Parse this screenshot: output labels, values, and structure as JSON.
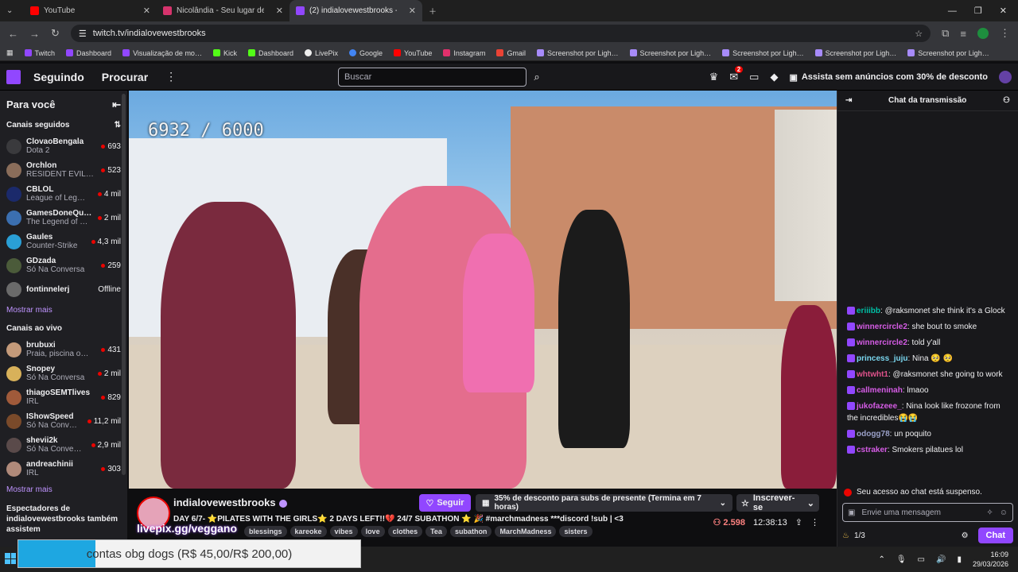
{
  "browser": {
    "tabs": [
      {
        "label": "YouTube",
        "color": "#ff0000"
      },
      {
        "label": "Nicolândia - Seu lugar de dive…",
        "color": "#d6336c"
      },
      {
        "label": "(2) indialovewestbrooks - Tw…",
        "color": "#9147ff"
      }
    ],
    "url": "twitch.tv/indialovewestbrooks",
    "bookmarks": [
      "Twitch",
      "Dashboard",
      "Visualização de mo…",
      "Kick",
      "Dashboard",
      "LivePix",
      "Google",
      "YouTube",
      "Instagram",
      "Gmail",
      "Screenshot por Ligh…",
      "Screenshot por Ligh…",
      "Screenshot por Ligh…",
      "Screenshot por Ligh…",
      "Screenshot por Ligh…"
    ]
  },
  "nav": {
    "following": "Seguindo",
    "browse": "Procurar",
    "search_placeholder": "Buscar",
    "notif_count": "2",
    "ad_free": "Assista sem anúncios com 30% de desconto"
  },
  "sidebar": {
    "title": "Para você",
    "followed_title": "Canais seguidos",
    "followed": [
      {
        "name": "ClovaoBengala",
        "game": "Dota 2",
        "viewers": "693",
        "color": "#3a3a3d"
      },
      {
        "name": "Orchlon",
        "game": "RESIDENT EVIL…",
        "viewers": "523",
        "color": "#8a6d5a"
      },
      {
        "name": "CBLOL",
        "game": "League of Leg…",
        "viewers": "4 mil",
        "color": "#1b2a6b"
      },
      {
        "name": "GamesDoneQu…",
        "game": "The Legend of …",
        "viewers": "2 mil",
        "color": "#3b6fb0"
      },
      {
        "name": "Gaules",
        "game": "Counter-Strike",
        "viewers": "4,3 mil",
        "color": "#2a9fd6"
      },
      {
        "name": "GDzada",
        "game": "Só Na Conversa",
        "viewers": "259",
        "color": "#4b5b3a"
      },
      {
        "name": "fontinnelerj",
        "game": "",
        "viewers": "Offline",
        "color": "#6a6a6a"
      }
    ],
    "show_more": "Mostrar mais",
    "live_title": "Canais ao vivo",
    "live": [
      {
        "name": "brubuxi",
        "game": "Praia, piscina o…",
        "viewers": "431",
        "color": "#c49a7a"
      },
      {
        "name": "Snopey",
        "game": "Só Na Conversa",
        "viewers": "2 mil",
        "color": "#d8b15a"
      },
      {
        "name": "thiagoSEMTlives",
        "game": "IRL",
        "viewers": "829",
        "color": "#a05a3a"
      },
      {
        "name": "IShowSpeed",
        "game": "Só Na Conv…",
        "viewers": "11,2 mil",
        "color": "#7a4a2a"
      },
      {
        "name": "shevii2k",
        "game": "Só Na Conve…",
        "viewers": "2,9 mil",
        "color": "#5a4a4a"
      },
      {
        "name": "andreachinii",
        "game": "IRL",
        "viewers": "303",
        "color": "#b08a7a"
      }
    ],
    "show_more2": "Mostrar mais",
    "suggest": "Espectadores de indialovewestbrooks também assistem"
  },
  "video": {
    "counter": "6932 / 6000"
  },
  "stream": {
    "channel": "indialovewestbrooks",
    "title": "DAY 6/7- ⭐PILATES WITH THE GIRLS⭐ 2 DAYS LEFT!!💔 24/7 SUBATHON ⭐ 🎉 #marchmadness ***discord !sub | <3",
    "follow": "Seguir",
    "gift": "35% de desconto para subs de presente (Termina em 7 horas)",
    "subscribe": "Inscrever-se",
    "overlay_link": "livepix.gg/veggano",
    "tags": [
      "blessings",
      "kareoke",
      "vibes",
      "love",
      "clothes",
      "Tea",
      "subathon",
      "MarchMadness",
      "sisters"
    ],
    "viewers": "2.598",
    "uptime": "12:38:13"
  },
  "chat": {
    "title": "Chat da transmissão",
    "messages": [
      {
        "user": "eriiibb",
        "color": "#00bfa5",
        "text": ": @raksmonet she think it's a Glock"
      },
      {
        "user": "winnercircle2",
        "color": "#d65ce6",
        "text": ": she bout to smoke"
      },
      {
        "user": "winnercircle2",
        "color": "#d65ce6",
        "text": ": told y'all"
      },
      {
        "user": "princess_juju",
        "color": "#7ad7f0",
        "text": ": Nina 🥺 🥺"
      },
      {
        "user": "whtwht1",
        "color": "#e0528b",
        "text": ": @raksmonet she going to work"
      },
      {
        "user": "callmeninah",
        "color": "#d65ce6",
        "text": ": lmaoo"
      },
      {
        "user": "jukofazeee_",
        "color": "#d65ce6",
        "text": ": Nina look like frozone from the incredibles😭😭"
      },
      {
        "user": "odogg78",
        "color": "#9aa0c8",
        "text": ": un poquito"
      },
      {
        "user": "cstraker",
        "color": "#d65ce6",
        "text": ": Smokers pilatues lol"
      }
    ],
    "warning": "Seu acesso ao chat está suspenso.",
    "placeholder": "Envie uma mensagem",
    "points": "1/3",
    "send": "Chat"
  },
  "overlay": {
    "text": "contas obg dogs (R$ 45,00/R$ 200,00)",
    "progress": 0.225
  },
  "taskbar": {
    "time": "16:09",
    "date": "29/03/2026"
  }
}
